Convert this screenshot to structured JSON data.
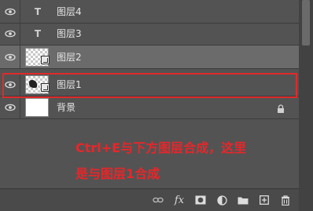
{
  "layers": [
    {
      "name": "图层4",
      "kind": "text",
      "type_glyph": "T",
      "selected": false
    },
    {
      "name": "图层3",
      "kind": "text",
      "type_glyph": "T",
      "selected": false
    },
    {
      "name": "图层2",
      "kind": "smart",
      "selected": true
    },
    {
      "name": "图层1",
      "kind": "smart",
      "selected": false,
      "highlighted": true
    },
    {
      "name": "背景",
      "kind": "background",
      "locked": true,
      "selected": false
    }
  ],
  "annotation": {
    "line1": "Ctrl+E与下方图层合成，这里",
    "line2": "是与图层1合成",
    "color": "#e8262a"
  },
  "colors": {
    "panel": "#535353",
    "selected_row": "#6b6b6b",
    "highlight": "#e02a2a"
  },
  "toolbar": {
    "icons": [
      "link-icon",
      "fx-icon",
      "mask-icon",
      "adjustment-icon",
      "folder-icon",
      "new-layer-icon",
      "trash-icon"
    ],
    "fx_label": "fx"
  }
}
